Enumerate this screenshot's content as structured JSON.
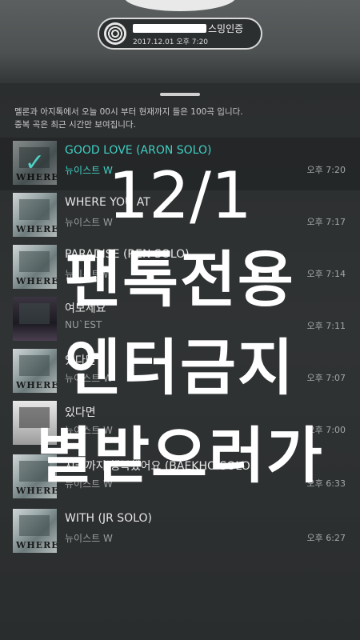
{
  "header": {
    "badge_title": "스밍인증",
    "badge_timestamp": "2017.12.01 오후 7:20"
  },
  "notice": {
    "line1": "멜론과 아지톡에서 오늘 00시 부터 현재까지 들은 100곡 입니다.",
    "line2": "중복 곡은 최근 시간만 보여집니다."
  },
  "songs": [
    {
      "title": "GOOD LOVE (ARON SOLO)",
      "artist": "뉴이스트 W",
      "time": "오후 7:20",
      "selected": true
    },
    {
      "title": "WHERE YOU AT",
      "artist": "뉴이스트 W",
      "time": "오후 7:17"
    },
    {
      "title": "PARADISE (REN SOLO)",
      "artist": "뉴이스트 W",
      "time": "오후 7:14"
    },
    {
      "title": "여보세요",
      "artist": "NU`EST",
      "time": "오후 7:11"
    },
    {
      "title": "있다면",
      "artist": "뉴이스트 W",
      "time": "오후 7:07"
    },
    {
      "title": "있다면",
      "artist": "뉴이스트 W",
      "time": "오후 7:00"
    },
    {
      "title": "지금까지 행복했어요 (BAEKHO SOLO)",
      "artist": "뉴이스트 W",
      "time": "오후 6:33"
    },
    {
      "title": "WITH (JR SOLO)",
      "artist": "뉴이스트 W",
      "time": "오후 6:27"
    }
  ],
  "album_art_text": "WHERE",
  "overlay": {
    "line1": "12/1",
    "line2": "팬톡전용",
    "line3": "엔터금지",
    "line4": "별받으러가"
  },
  "colors": {
    "accent": "#3fd0c4"
  }
}
